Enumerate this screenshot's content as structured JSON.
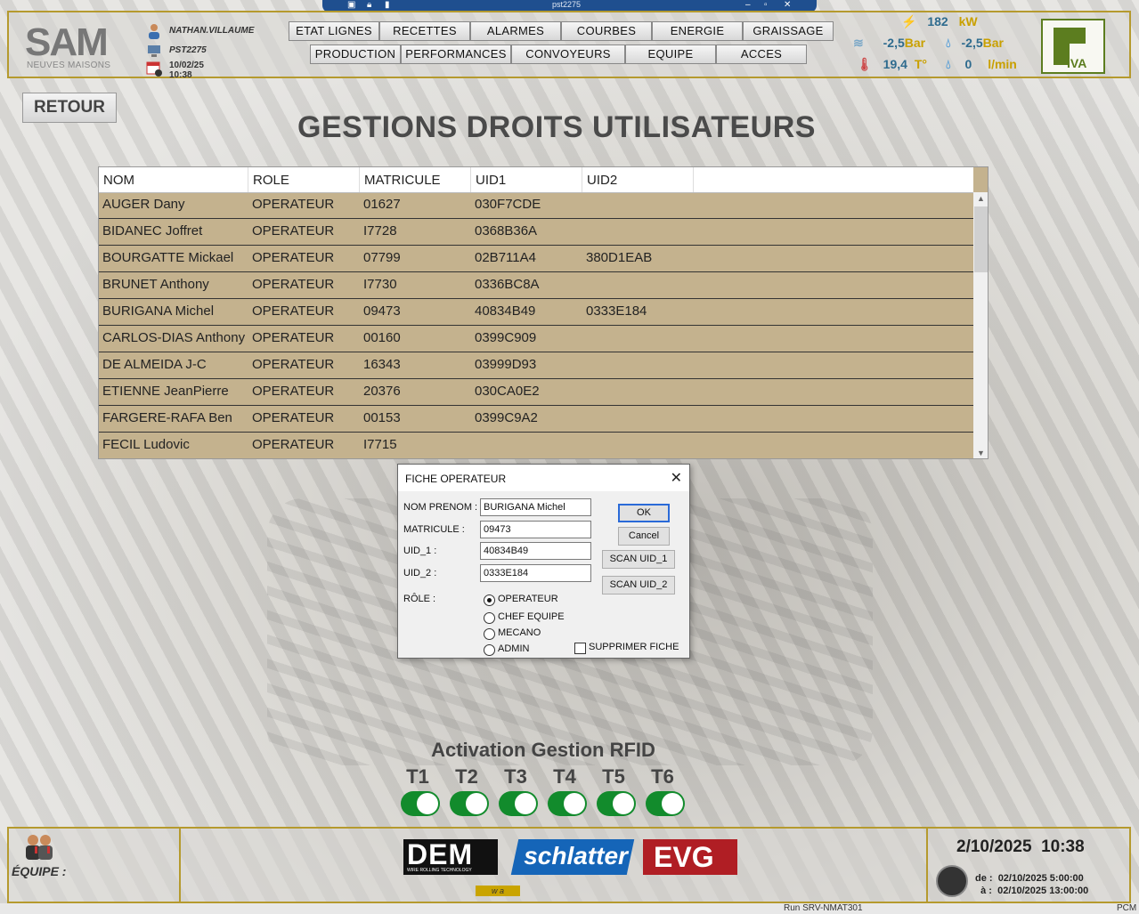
{
  "window": {
    "title": "pst2275"
  },
  "header": {
    "user": "NATHAN.VILLAUME",
    "station": "PST2275",
    "date": "10/02/25",
    "time": "10:38",
    "logo_text": "SAM",
    "logo_sub": "NEUVES MAISONS",
    "nav_row1": [
      "ETAT LIGNES",
      "RECETTES",
      "ALARMES",
      "COURBES",
      "ENERGIE",
      "GRAISSAGE"
    ],
    "nav_row2": [
      "PRODUCTION",
      "PERFORMANCES",
      "CONVOYEURS",
      "EQUIPE",
      "ACCES"
    ],
    "power_value": "182",
    "power_unit": "kW",
    "air_pressure": "-2,5",
    "air_pressure_unit": "Bar",
    "water_pressure": "-2,5",
    "water_pressure_unit": "Bar",
    "temperature": "19,4",
    "temperature_unit": "T°",
    "flow_value": "0",
    "flow_unit": "l/min",
    "brand_logo_text": "IVA"
  },
  "page": {
    "back_label": "RETOUR",
    "title": "GESTIONS DROITS UTILISATEURS"
  },
  "table": {
    "columns": [
      "NOM",
      "ROLE",
      "MATRICULE",
      "UID1",
      "UID2"
    ],
    "rows": [
      {
        "nom": "AUGER Dany",
        "role": "OPERATEUR",
        "matricule": "01627",
        "uid1": "030F7CDE",
        "uid2": ""
      },
      {
        "nom": "BIDANEC  Joffret",
        "role": "OPERATEUR",
        "matricule": "I7728",
        "uid1": "0368B36A",
        "uid2": ""
      },
      {
        "nom": "BOURGATTE Mickael",
        "role": "OPERATEUR",
        "matricule": "07799",
        "uid1": "02B711A4",
        "uid2": "380D1EAB"
      },
      {
        "nom": "BRUNET Anthony",
        "role": "OPERATEUR",
        "matricule": "I7730",
        "uid1": "0336BC8A",
        "uid2": ""
      },
      {
        "nom": "BURIGANA Michel",
        "role": "OPERATEUR",
        "matricule": "09473",
        "uid1": "40834B49",
        "uid2": "0333E184"
      },
      {
        "nom": "CARLOS-DIAS Anthony",
        "role": "OPERATEUR",
        "matricule": "00160",
        "uid1": "0399C909",
        "uid2": ""
      },
      {
        "nom": "DE ALMEIDA J-C",
        "role": "OPERATEUR",
        "matricule": "16343",
        "uid1": "03999D93",
        "uid2": ""
      },
      {
        "nom": "ETIENNE JeanPierre",
        "role": "OPERATEUR",
        "matricule": "20376",
        "uid1": "030CA0E2",
        "uid2": ""
      },
      {
        "nom": "FARGERE-RAFA Ben",
        "role": "OPERATEUR",
        "matricule": "00153",
        "uid1": "0399C9A2",
        "uid2": ""
      },
      {
        "nom": "FECIL Ludovic",
        "role": "OPERATEUR",
        "matricule": "I7715",
        "uid1": "",
        "uid2": ""
      }
    ]
  },
  "dialog": {
    "title": "FICHE OPERATEUR",
    "nom_label": "NOM PRENOM :",
    "nom_value": "BURIGANA Michel",
    "matricule_label": "MATRICULE :",
    "matricule_value": "09473",
    "uid1_label": "UID_1 :",
    "uid1_value": "40834B49",
    "uid2_label": "UID_2 :",
    "uid2_value": "0333E184",
    "role_label": "RÔLE :",
    "roles": [
      "OPERATEUR",
      "CHEF EQUIPE",
      "MECANO",
      "ADMIN"
    ],
    "selected_role": "OPERATEUR",
    "ok_label": "OK",
    "cancel_label": "Cancel",
    "scan1_label": "SCAN UID_1",
    "scan2_label": "SCAN UID_2",
    "delete_label": "SUPPRIMER FICHE",
    "delete_checked": false
  },
  "rfid": {
    "title": "Activation Gestion RFID",
    "terminals": [
      {
        "label": "T1",
        "on": true
      },
      {
        "label": "T2",
        "on": true
      },
      {
        "label": "T3",
        "on": true
      },
      {
        "label": "T4",
        "on": true
      },
      {
        "label": "T5",
        "on": true
      },
      {
        "label": "T6",
        "on": true
      }
    ],
    "toggle_color": "#128b2c"
  },
  "footer": {
    "equipe_label": "ÉQUIPE :",
    "date": "2/10/2025",
    "time": "10:38",
    "de_label": "de :",
    "de_value": "02/10/2025 5:00:00",
    "a_label": "à :",
    "a_value": "02/10/2025 13:00:00",
    "logos": [
      "DEM",
      "schlatter",
      "EVG"
    ],
    "dem_sub": "WIRE ROLLING TECHNOLOGY",
    "wa_text": "w a"
  },
  "status_bar": {
    "left_text": "Run   SRV-NMAT301",
    "right_text": "PCM"
  },
  "colors": {
    "gold_border": "#b59a2e",
    "table_row": "#c4b28e",
    "accent_blue": "#2e6b8e"
  }
}
